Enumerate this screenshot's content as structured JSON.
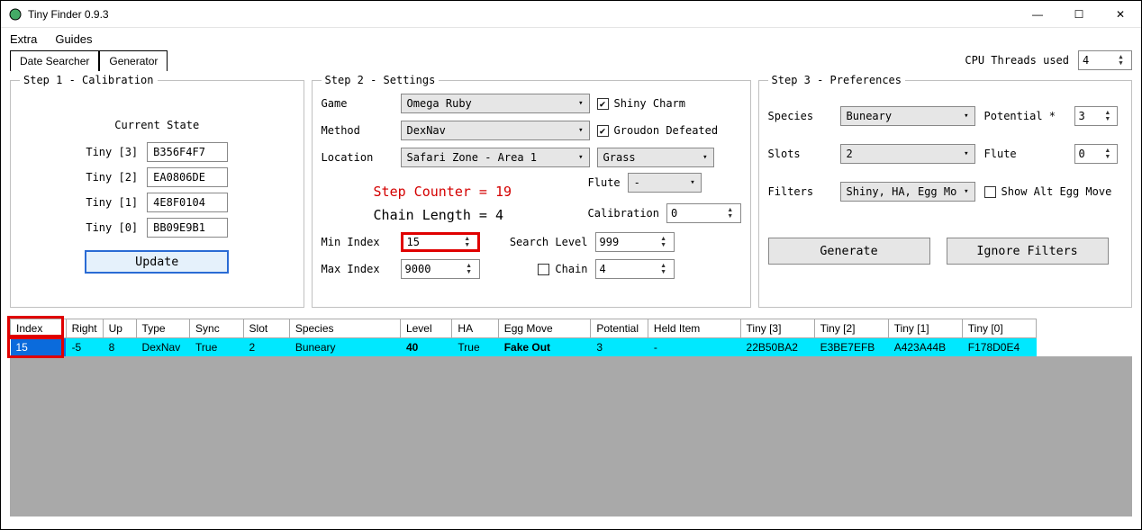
{
  "window": {
    "title": "Tiny Finder 0.9.3"
  },
  "menu": {
    "extra": "Extra",
    "guides": "Guides"
  },
  "threads": {
    "label": "CPU Threads used",
    "value": "4"
  },
  "tabs": {
    "date_searcher": "Date Searcher",
    "generator": "Generator"
  },
  "step1": {
    "legend": "Step 1 - Calibration",
    "current_state": "Current State",
    "tiny3_label": "Tiny [3]",
    "tiny3": "B356F4F7",
    "tiny2_label": "Tiny [2]",
    "tiny2": "EA0806DE",
    "tiny1_label": "Tiny [1]",
    "tiny1": "4E8F0104",
    "tiny0_label": "Tiny [0]",
    "tiny0": "BB09E9B1",
    "update": "Update"
  },
  "step2": {
    "legend": "Step 2 - Settings",
    "game_label": "Game",
    "game": "Omega Ruby",
    "method_label": "Method",
    "method": "DexNav",
    "location_label": "Location",
    "location": "Safari Zone - Area 1",
    "terrain": "Grass",
    "flute_label": "Flute",
    "flute": "-",
    "shiny_charm": "Shiny Charm",
    "groudon": "Groudon Defeated",
    "step_counter": "Step Counter  =  19",
    "chain_length": "Chain Length  =  4",
    "calibration_label": "Calibration",
    "calibration": "0",
    "search_level_label": "Search Level",
    "search_level": "999",
    "chain_label": "Chain",
    "chain": "4",
    "min_index_label": "Min Index",
    "min_index": "15",
    "max_index_label": "Max Index",
    "max_index": "9000"
  },
  "step3": {
    "legend": "Step 3 - Preferences",
    "species_label": "Species",
    "species": "Buneary",
    "potential_label": "Potential *",
    "potential": "3",
    "slots_label": "Slots",
    "slots": "2",
    "flute_label": "Flute",
    "flute": "0",
    "filters_label": "Filters",
    "filters": "Shiny, HA, Egg Mo",
    "show_alt": "Show Alt Egg Move",
    "generate": "Generate",
    "ignore": "Ignore Filters"
  },
  "table": {
    "headers": {
      "index": "Index",
      "right": "Right",
      "up": "Up",
      "type": "Type",
      "sync": "Sync",
      "slot": "Slot",
      "species": "Species",
      "level": "Level",
      "ha": "HA",
      "egg_move": "Egg Move",
      "potential": "Potential",
      "held_item": "Held Item",
      "tiny3": "Tiny [3]",
      "tiny2": "Tiny [2]",
      "tiny1": "Tiny [1]",
      "tiny0": "Tiny [0]"
    },
    "row": {
      "index": "15",
      "right": "-5",
      "up": "8",
      "type": "DexNav",
      "sync": "True",
      "slot": "2",
      "species": "Buneary",
      "level": "40",
      "ha": "True",
      "egg_move": "Fake Out",
      "potential": "3",
      "held_item": "-",
      "tiny3": "22B50BA2",
      "tiny2": "E3BE7EFB",
      "tiny1": "A423A44B",
      "tiny0": "F178D0E4"
    }
  }
}
